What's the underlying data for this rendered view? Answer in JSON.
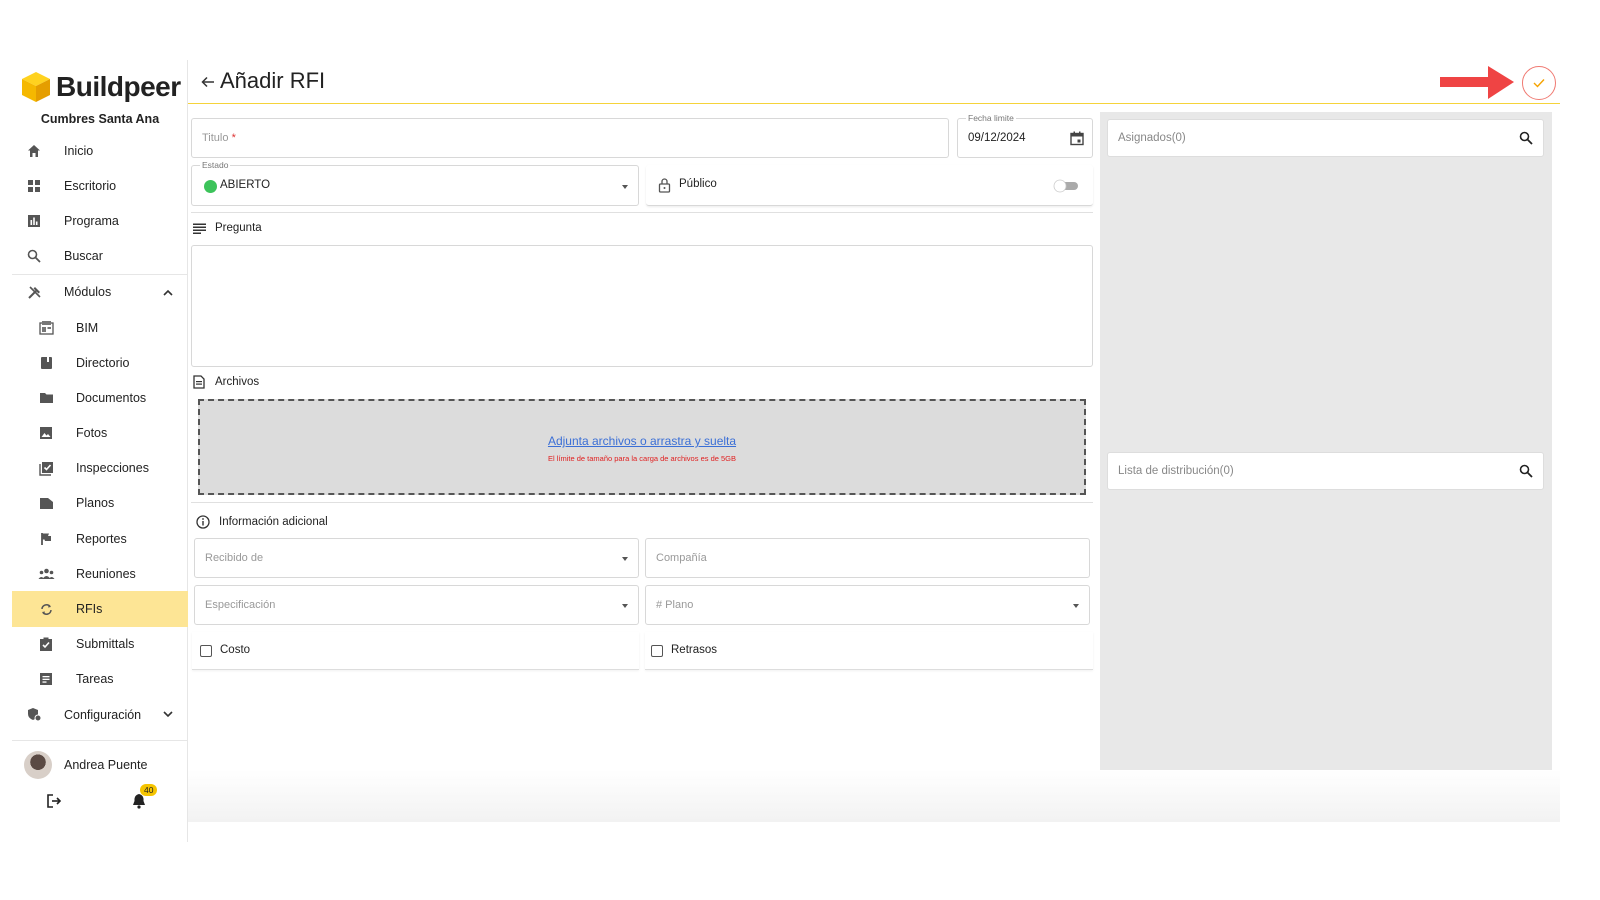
{
  "brand": {
    "name": "Buildpeer",
    "project": "Cumbres Santa Ana",
    "accent": "#f5c400"
  },
  "sidebar": {
    "items": [
      {
        "label": "Inicio",
        "icon": "home-icon"
      },
      {
        "label": "Escritorio",
        "icon": "dashboard-icon"
      },
      {
        "label": "Programa",
        "icon": "chart-icon"
      },
      {
        "label": "Buscar",
        "icon": "search-icon"
      },
      {
        "label": "Módulos",
        "icon": "tools-icon"
      },
      {
        "label": "BIM",
        "icon": "bim-icon"
      },
      {
        "label": "Directorio",
        "icon": "book-icon"
      },
      {
        "label": "Documentos",
        "icon": "folder-icon"
      },
      {
        "label": "Fotos",
        "icon": "image-icon"
      },
      {
        "label": "Inspecciones",
        "icon": "checklist-icon"
      },
      {
        "label": "Planos",
        "icon": "plans-icon"
      },
      {
        "label": "Reportes",
        "icon": "flag-icon"
      },
      {
        "label": "Reuniones",
        "icon": "people-icon"
      },
      {
        "label": "RFIs",
        "icon": "sync-icon"
      },
      {
        "label": "Submittals",
        "icon": "clipboard-check-icon"
      },
      {
        "label": "Tareas",
        "icon": "tasks-icon"
      },
      {
        "label": "Configuración",
        "icon": "settings-shield-icon"
      }
    ],
    "active": "RFIs",
    "user": {
      "name": "Andrea Puente",
      "notifications": "40"
    }
  },
  "header": {
    "title": "Añadir RFI"
  },
  "form": {
    "titulo": {
      "label": "Titulo",
      "required_mark": "*"
    },
    "fecha": {
      "label": "Fecha limite",
      "value": "09/12/2024"
    },
    "estado": {
      "label": "Estado",
      "value": "ABIERTO",
      "status_color": "#3cc35a"
    },
    "publico": {
      "label": "Público",
      "on": false
    },
    "pregunta": {
      "label": "Pregunta"
    },
    "archivos": {
      "label": "Archivos",
      "link": "Adjunta archivos o arrastra y suelta",
      "note": "El límite de tamaño para la carga de archivos es de 5GB"
    },
    "info": {
      "label": "Información adicional",
      "recibido": "Recibido de",
      "compania": "Compañía",
      "especificacion": "Especificación",
      "plano": "# Plano",
      "costo": "Costo",
      "retrasos": "Retrasos"
    }
  },
  "right": {
    "asignados": "Asignados(0)",
    "distribucion": "Lista de distribución(0)"
  }
}
